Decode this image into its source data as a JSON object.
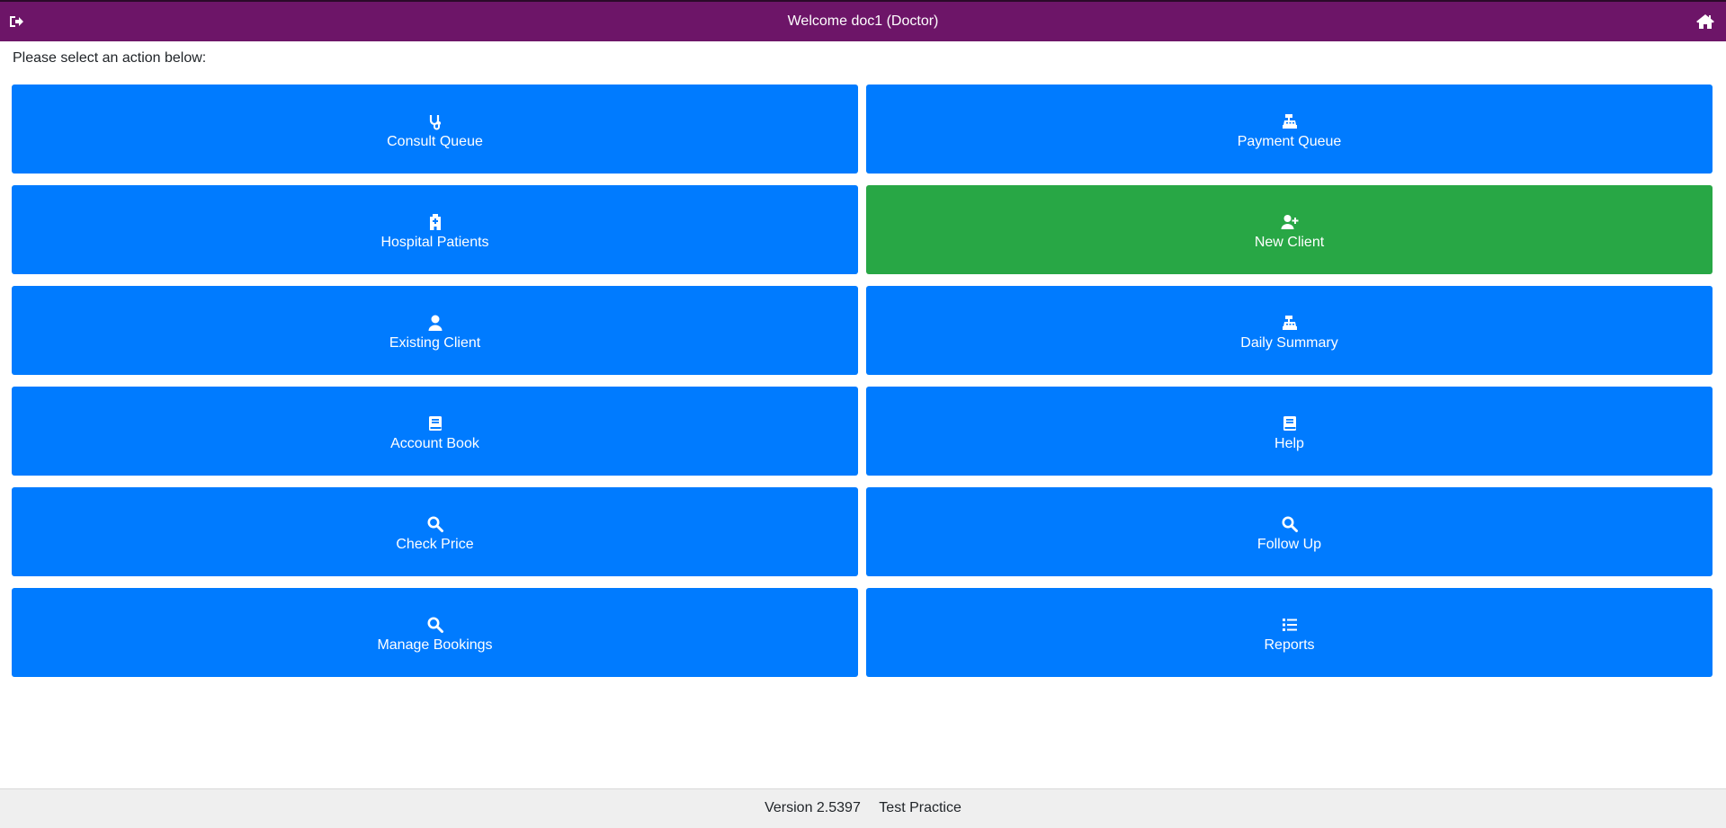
{
  "header": {
    "title": "Welcome doc1 (Doctor)",
    "logout_icon": "sign-out-icon",
    "home_icon": "home-icon",
    "color": "#6d1568"
  },
  "prompt": "Please select an action below:",
  "actions": [
    {
      "label": "Consult Queue",
      "icon": "stethoscope-icon",
      "color": "#007bff"
    },
    {
      "label": "Payment Queue",
      "icon": "cash-register-icon",
      "color": "#007bff"
    },
    {
      "label": "Hospital Patients",
      "icon": "hospital-icon",
      "color": "#007bff"
    },
    {
      "label": "New Client",
      "icon": "user-plus-icon",
      "color": "#28a745"
    },
    {
      "label": "Existing Client",
      "icon": "user-icon",
      "color": "#007bff"
    },
    {
      "label": "Daily Summary",
      "icon": "cash-register-icon",
      "color": "#007bff"
    },
    {
      "label": "Account Book",
      "icon": "book-icon",
      "color": "#007bff"
    },
    {
      "label": "Help",
      "icon": "book-icon",
      "color": "#007bff"
    },
    {
      "label": "Check Price",
      "icon": "search-icon",
      "color": "#007bff"
    },
    {
      "label": "Follow Up",
      "icon": "search-icon",
      "color": "#007bff"
    },
    {
      "label": "Manage Bookings",
      "icon": "search-icon",
      "color": "#007bff"
    },
    {
      "label": "Reports",
      "icon": "list-icon",
      "color": "#007bff"
    }
  ],
  "footer": {
    "version": "Version 2.5397",
    "practice": "Test Practice"
  }
}
